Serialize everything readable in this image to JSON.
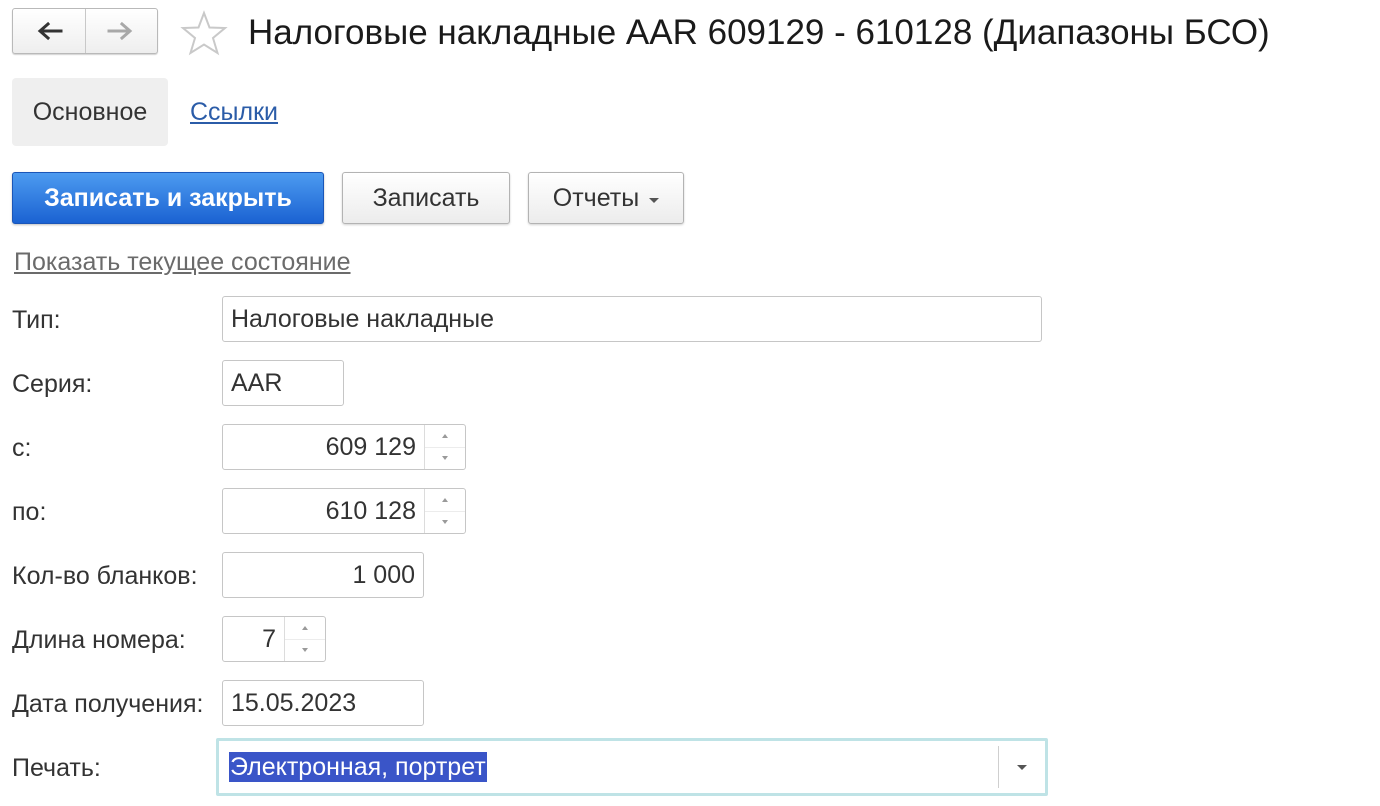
{
  "window": {
    "title": "Налоговые накладные AAR 609129 - 610128 (Диапазоны БСО)"
  },
  "tabs": [
    {
      "label": "Основное",
      "active": true
    },
    {
      "label": "Ссылки",
      "active": false
    }
  ],
  "toolbar": {
    "save_close_label": "Записать и закрыть",
    "save_label": "Записать",
    "reports_label": "Отчеты"
  },
  "show_state_link": "Показать текущее состояние",
  "form": {
    "type": {
      "label": "Тип:",
      "value": "Налоговые накладные"
    },
    "series": {
      "label": "Серия:",
      "value": "AAR"
    },
    "from": {
      "label": "с:",
      "value": "609 129"
    },
    "to": {
      "label": "по:",
      "value": "610 128"
    },
    "count": {
      "label": "Кол-во бланков:",
      "value": "1 000"
    },
    "number_length": {
      "label": "Длина номера:",
      "value": "7"
    },
    "date_received": {
      "label": "Дата получения:",
      "value": "15.05.2023"
    },
    "print": {
      "label": "Печать:",
      "value": "Электронная, портрет"
    }
  },
  "colors": {
    "primary_button": "#1b62d2",
    "link": "#2b5ca8",
    "selection": "#3a55c8",
    "focus_border": "#bfe3e6"
  },
  "icons": [
    "arrow-left-icon",
    "arrow-right-icon",
    "star-icon",
    "chevron-down-icon"
  ]
}
